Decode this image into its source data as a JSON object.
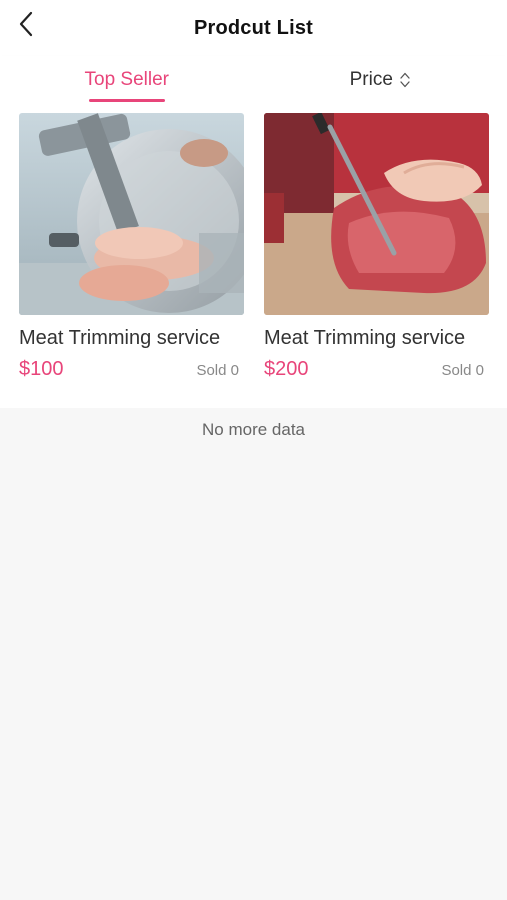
{
  "header": {
    "title": "Prodcut List",
    "back_icon": "back-arrow-icon"
  },
  "tabs": [
    {
      "label": "Top Seller",
      "active": true
    },
    {
      "label": "Price",
      "icon": "sort-arrows-icon",
      "active": false
    }
  ],
  "products": [
    {
      "title": "Meat Trimming service",
      "price": "$100",
      "sold": "Sold 0",
      "image": "meat-slicer-photo"
    },
    {
      "title": "Meat Trimming service",
      "price": "$200",
      "sold": "Sold 0",
      "image": "beef-cutting-photo"
    }
  ],
  "footer": {
    "no_more": "No more data"
  },
  "colors": {
    "accent": "#e8457a",
    "background": "#f7f7f7"
  }
}
